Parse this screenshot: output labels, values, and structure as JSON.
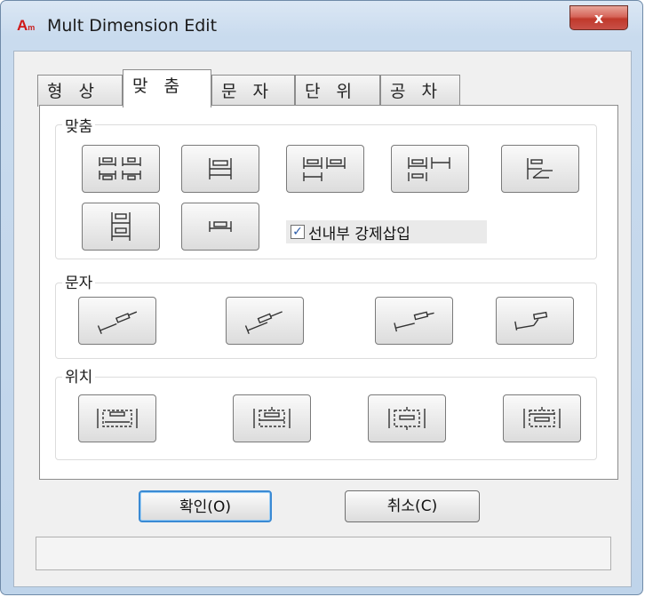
{
  "window": {
    "title": "Mult Dimension Edit",
    "app_icon_letter": "A",
    "app_icon_sub": "m",
    "close_label": "x",
    "icon_names": {
      "app": "autocad-icon",
      "close": "close-icon"
    }
  },
  "tabs": [
    {
      "label": "형 상",
      "active": false
    },
    {
      "label": "맞 춤",
      "active": true
    },
    {
      "label": "문 자",
      "active": false
    },
    {
      "label": "단 위",
      "active": false
    },
    {
      "label": "공 차",
      "active": false
    }
  ],
  "groups": {
    "alignment": {
      "label": "맞춤"
    },
    "text": {
      "label": "문자"
    },
    "position": {
      "label": "위치"
    }
  },
  "checkbox": {
    "label": "선내부 강제삽입",
    "checked": true
  },
  "buttons": {
    "ok": "확인(O)",
    "cancel": "취소(C)"
  },
  "colors": {
    "accent": "#3a8ad4",
    "close": "#c0392b",
    "app_icon": "#d01818"
  }
}
